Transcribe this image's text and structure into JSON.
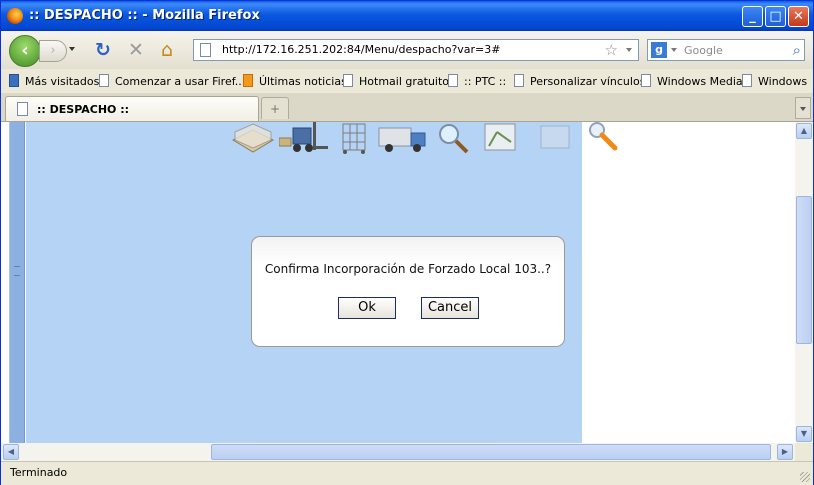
{
  "window": {
    "title": ":: DESPACHO :: - Mozilla Firefox"
  },
  "navigation": {
    "url": "http://172.16.251.202:84/Menu/despacho?var=3#",
    "search_placeholder": "Google"
  },
  "bookmarks": [
    {
      "label": "Más visitados",
      "icon": "most-visited-icon"
    },
    {
      "label": "Comenzar a usar Firef...",
      "icon": "page-icon"
    },
    {
      "label": "Últimas noticias",
      "icon": "rss-icon"
    },
    {
      "label": "Hotmail gratuito",
      "icon": "page-icon"
    },
    {
      "label": ":: PTC ::",
      "icon": "page-icon"
    },
    {
      "label": "Personalizar vínculos",
      "icon": "page-icon"
    },
    {
      "label": "Windows Media",
      "icon": "page-icon"
    },
    {
      "label": "Windows",
      "icon": "page-icon"
    }
  ],
  "tabs": [
    {
      "label": ":: DESPACHO ::"
    }
  ],
  "dialog": {
    "message": "Confirma Incorporación de Forzado Local 103..?",
    "ok_label": "Ok",
    "cancel_label": "Cancel"
  },
  "status": {
    "text": "Terminado"
  },
  "colors": {
    "titlebar": "#0a58e0",
    "page_panel": "#b5d3f4",
    "left_strip": "#8cb0e0"
  }
}
